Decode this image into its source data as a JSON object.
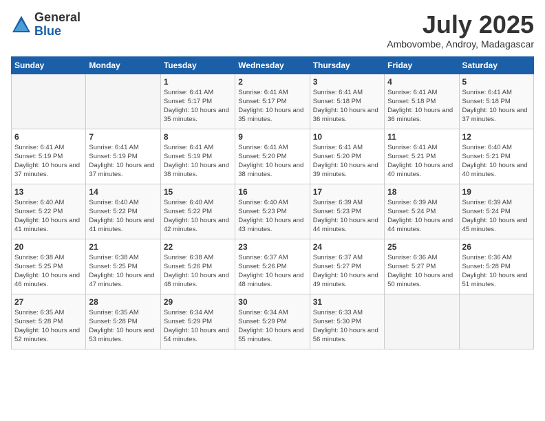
{
  "logo": {
    "general": "General",
    "blue": "Blue"
  },
  "title": {
    "month": "July 2025",
    "location": "Ambovombe, Androy, Madagascar"
  },
  "days_of_week": [
    "Sunday",
    "Monday",
    "Tuesday",
    "Wednesday",
    "Thursday",
    "Friday",
    "Saturday"
  ],
  "weeks": [
    [
      {
        "day": "",
        "info": ""
      },
      {
        "day": "",
        "info": ""
      },
      {
        "day": "1",
        "info": "Sunrise: 6:41 AM\nSunset: 5:17 PM\nDaylight: 10 hours and 35 minutes."
      },
      {
        "day": "2",
        "info": "Sunrise: 6:41 AM\nSunset: 5:17 PM\nDaylight: 10 hours and 35 minutes."
      },
      {
        "day": "3",
        "info": "Sunrise: 6:41 AM\nSunset: 5:18 PM\nDaylight: 10 hours and 36 minutes."
      },
      {
        "day": "4",
        "info": "Sunrise: 6:41 AM\nSunset: 5:18 PM\nDaylight: 10 hours and 36 minutes."
      },
      {
        "day": "5",
        "info": "Sunrise: 6:41 AM\nSunset: 5:18 PM\nDaylight: 10 hours and 37 minutes."
      }
    ],
    [
      {
        "day": "6",
        "info": "Sunrise: 6:41 AM\nSunset: 5:19 PM\nDaylight: 10 hours and 37 minutes."
      },
      {
        "day": "7",
        "info": "Sunrise: 6:41 AM\nSunset: 5:19 PM\nDaylight: 10 hours and 37 minutes."
      },
      {
        "day": "8",
        "info": "Sunrise: 6:41 AM\nSunset: 5:19 PM\nDaylight: 10 hours and 38 minutes."
      },
      {
        "day": "9",
        "info": "Sunrise: 6:41 AM\nSunset: 5:20 PM\nDaylight: 10 hours and 38 minutes."
      },
      {
        "day": "10",
        "info": "Sunrise: 6:41 AM\nSunset: 5:20 PM\nDaylight: 10 hours and 39 minutes."
      },
      {
        "day": "11",
        "info": "Sunrise: 6:41 AM\nSunset: 5:21 PM\nDaylight: 10 hours and 40 minutes."
      },
      {
        "day": "12",
        "info": "Sunrise: 6:40 AM\nSunset: 5:21 PM\nDaylight: 10 hours and 40 minutes."
      }
    ],
    [
      {
        "day": "13",
        "info": "Sunrise: 6:40 AM\nSunset: 5:22 PM\nDaylight: 10 hours and 41 minutes."
      },
      {
        "day": "14",
        "info": "Sunrise: 6:40 AM\nSunset: 5:22 PM\nDaylight: 10 hours and 41 minutes."
      },
      {
        "day": "15",
        "info": "Sunrise: 6:40 AM\nSunset: 5:22 PM\nDaylight: 10 hours and 42 minutes."
      },
      {
        "day": "16",
        "info": "Sunrise: 6:40 AM\nSunset: 5:23 PM\nDaylight: 10 hours and 43 minutes."
      },
      {
        "day": "17",
        "info": "Sunrise: 6:39 AM\nSunset: 5:23 PM\nDaylight: 10 hours and 44 minutes."
      },
      {
        "day": "18",
        "info": "Sunrise: 6:39 AM\nSunset: 5:24 PM\nDaylight: 10 hours and 44 minutes."
      },
      {
        "day": "19",
        "info": "Sunrise: 6:39 AM\nSunset: 5:24 PM\nDaylight: 10 hours and 45 minutes."
      }
    ],
    [
      {
        "day": "20",
        "info": "Sunrise: 6:38 AM\nSunset: 5:25 PM\nDaylight: 10 hours and 46 minutes."
      },
      {
        "day": "21",
        "info": "Sunrise: 6:38 AM\nSunset: 5:25 PM\nDaylight: 10 hours and 47 minutes."
      },
      {
        "day": "22",
        "info": "Sunrise: 6:38 AM\nSunset: 5:26 PM\nDaylight: 10 hours and 48 minutes."
      },
      {
        "day": "23",
        "info": "Sunrise: 6:37 AM\nSunset: 5:26 PM\nDaylight: 10 hours and 48 minutes."
      },
      {
        "day": "24",
        "info": "Sunrise: 6:37 AM\nSunset: 5:27 PM\nDaylight: 10 hours and 49 minutes."
      },
      {
        "day": "25",
        "info": "Sunrise: 6:36 AM\nSunset: 5:27 PM\nDaylight: 10 hours and 50 minutes."
      },
      {
        "day": "26",
        "info": "Sunrise: 6:36 AM\nSunset: 5:28 PM\nDaylight: 10 hours and 51 minutes."
      }
    ],
    [
      {
        "day": "27",
        "info": "Sunrise: 6:35 AM\nSunset: 5:28 PM\nDaylight: 10 hours and 52 minutes."
      },
      {
        "day": "28",
        "info": "Sunrise: 6:35 AM\nSunset: 5:28 PM\nDaylight: 10 hours and 53 minutes."
      },
      {
        "day": "29",
        "info": "Sunrise: 6:34 AM\nSunset: 5:29 PM\nDaylight: 10 hours and 54 minutes."
      },
      {
        "day": "30",
        "info": "Sunrise: 6:34 AM\nSunset: 5:29 PM\nDaylight: 10 hours and 55 minutes."
      },
      {
        "day": "31",
        "info": "Sunrise: 6:33 AM\nSunset: 5:30 PM\nDaylight: 10 hours and 56 minutes."
      },
      {
        "day": "",
        "info": ""
      },
      {
        "day": "",
        "info": ""
      }
    ]
  ]
}
